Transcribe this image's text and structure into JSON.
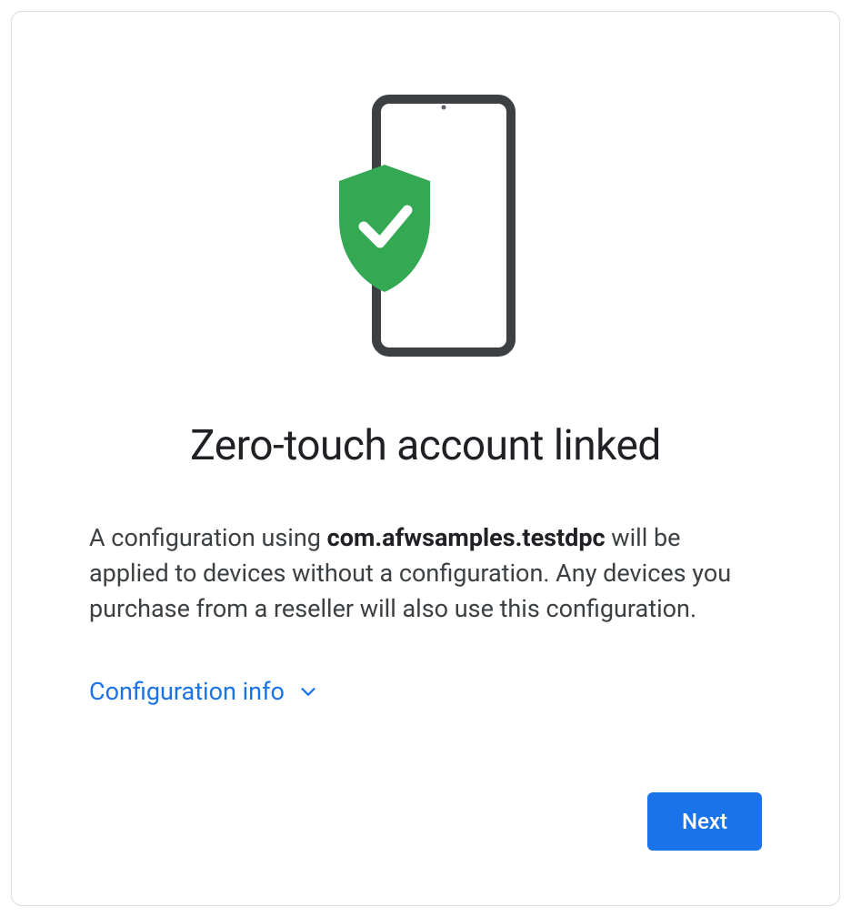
{
  "title": "Zero-touch account linked",
  "description": {
    "prefix": "A configuration using ",
    "package": "com.afwsamples.testdpc",
    "suffix": " will be applied to devices without a configuration. Any devices you purchase from a reseller will also use this configuration."
  },
  "config_toggle": {
    "label": "Configuration info"
  },
  "buttons": {
    "next": "Next"
  },
  "colors": {
    "primary": "#1a73e8",
    "shield": "#34a853",
    "text": "#202124"
  }
}
